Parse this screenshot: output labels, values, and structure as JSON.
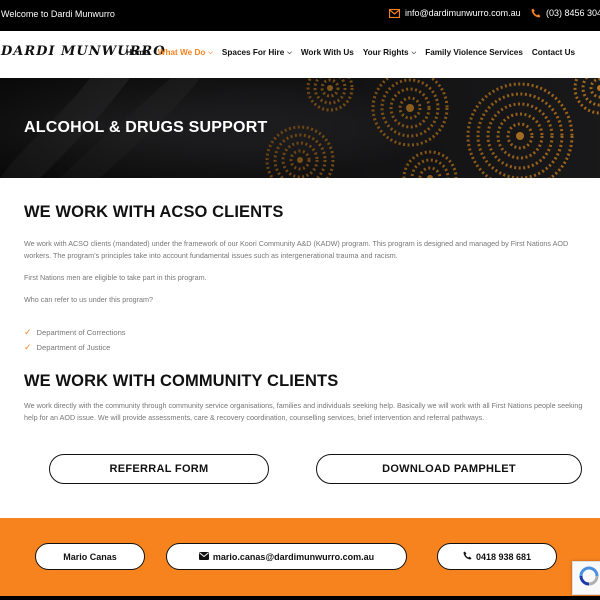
{
  "topbar": {
    "welcome": "Welcome to Dardi Munwurro",
    "email": "info@dardimunwurro.com.au",
    "phone": "(03) 8456 304"
  },
  "header": {
    "logo": "DARDI MUNWURRO",
    "nav": [
      {
        "label": "Home",
        "active": false,
        "dropdown": false
      },
      {
        "label": "What We Do",
        "active": true,
        "dropdown": true
      },
      {
        "label": "Spaces For Hire",
        "active": false,
        "dropdown": true
      },
      {
        "label": "Work With Us",
        "active": false,
        "dropdown": false
      },
      {
        "label": "Your Rights",
        "active": false,
        "dropdown": true
      },
      {
        "label": "Family Violence Services",
        "active": false,
        "dropdown": false
      },
      {
        "label": "Contact Us",
        "active": false,
        "dropdown": false
      }
    ]
  },
  "hero": {
    "title": "ALCOHOL & DRUGS SUPPORT"
  },
  "acso": {
    "heading": "WE WORK WITH ACSO CLIENTS",
    "para1": "We work with ACSO clients (mandated) under the framework of our Koori Community A&D (KADW) program. This program is designed and managed by First Nations AOD workers. The program’s principles take into account fundamental issues such as intergenerational trauma and racism.",
    "para2": "First Nations men are eligible to take part in this program.",
    "para3": "Who can refer to us under this program?",
    "list": [
      "Department of Corrections",
      "Department of Justice"
    ]
  },
  "community": {
    "heading": "WE WORK WITH COMMUNITY CLIENTS",
    "para": "We work directly with the community through community service organisations, families and individuals seeking help. Basically we will work with all First Nations people seeking help for an AOD issue. We will provide assessments, care & recovery coordination, counselling services, brief intervention and referral pathways."
  },
  "buttons": {
    "referral": "REFERRAL FORM",
    "pamphlet": "DOWNLOAD PAMPHLET"
  },
  "footer": {
    "name": "Mario Canas",
    "email": "mario.canas@dardimunwurro.com.au",
    "phone": "0418 938 681"
  },
  "colors": {
    "accent": "#f7831f",
    "dark": "#000000"
  }
}
